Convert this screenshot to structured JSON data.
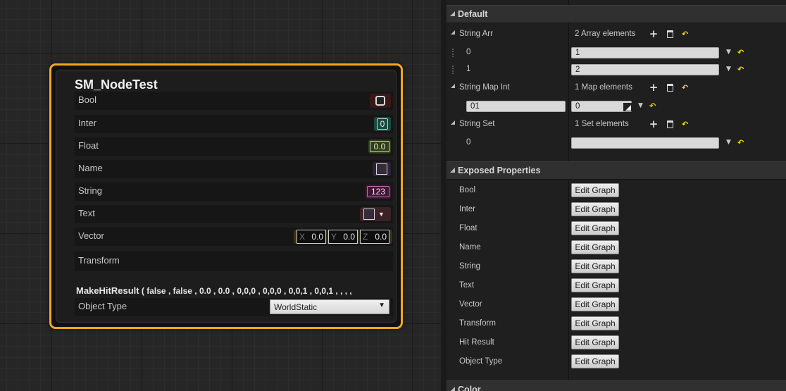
{
  "node": {
    "title": "SM_NodeTest",
    "pins": [
      {
        "label": "Bool"
      },
      {
        "label": "Inter",
        "value": "0"
      },
      {
        "label": "Float",
        "value": "0.0"
      },
      {
        "label": "Name"
      },
      {
        "label": "String",
        "value": "123"
      },
      {
        "label": "Text"
      },
      {
        "label": "Vector",
        "x_label": "X",
        "x": "0.0",
        "y_label": "Y",
        "y": "0.0",
        "z_label": "Z",
        "z": "0.0"
      },
      {
        "label": "Transform"
      },
      {
        "label": "Object Type",
        "value": "WorldStatic"
      }
    ],
    "hit_result": {
      "func": "MakeHitResult",
      "args": "( false , false , 0.0 , 0.0 , 0,0,0 , 0,0,0 , 0,0,1 , 0,0,1 , , , ,"
    }
  },
  "details": {
    "default": {
      "title": "Default",
      "string_arr": {
        "label": "String Arr",
        "summary": "2 Array elements",
        "items": [
          {
            "index": "0",
            "value": "1"
          },
          {
            "index": "1",
            "value": "2"
          }
        ]
      },
      "string_map_int": {
        "label": "String Map Int",
        "summary": "1 Map elements",
        "key": "01",
        "value": "0"
      },
      "string_set": {
        "label": "String Set",
        "summary": "1 Set elements",
        "items": [
          {
            "index": "0",
            "value": ""
          }
        ]
      }
    },
    "exposed": {
      "title": "Exposed Properties",
      "button_label": "Edit Graph",
      "items": [
        "Bool",
        "Inter",
        "Float",
        "Name",
        "String",
        "Text",
        "Vector",
        "Transform",
        "Hit Result",
        "Object Type"
      ]
    },
    "color": {
      "title": "Color"
    }
  },
  "colors": {
    "node_border": "#f3a81f",
    "bool_pin": "#5a1414",
    "int_pin": "#1e6b5a",
    "float_pin": "#5a8a1e",
    "name_pin": "#5b3d7a",
    "string_pin": "#a0208a",
    "text_pin": "#c8788a",
    "vector_pin": "#e0b020",
    "reset_arrow": "#f2d321"
  }
}
